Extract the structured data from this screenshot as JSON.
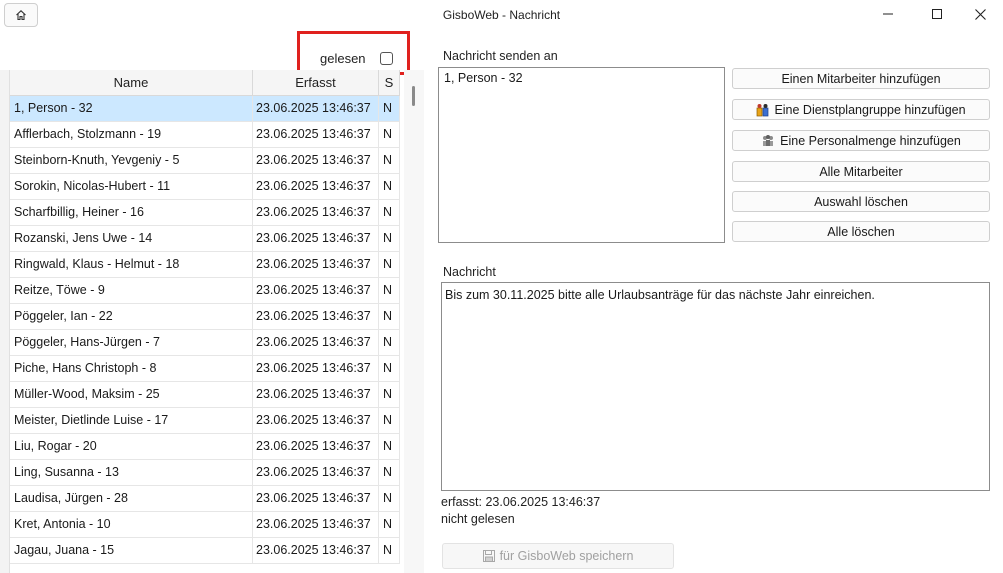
{
  "window": {
    "title": "GisboWeb - Nachricht",
    "home_icon": "home-icon",
    "minimize_icon": "minimize-icon",
    "maximize_icon": "maximize-icon",
    "close_icon": "close-icon"
  },
  "filter": {
    "gelesen_label": "gelesen",
    "gelesen_checked": false
  },
  "table": {
    "columns": [
      "Name",
      "Erfasst",
      "S"
    ],
    "rows": [
      {
        "name": "1, Person - 32",
        "erfasst": "23.06.2025 13:46:37",
        "s": "N"
      },
      {
        "name": "Afflerbach, Stolzmann - 19",
        "erfasst": "23.06.2025 13:46:37",
        "s": "N"
      },
      {
        "name": "Steinborn-Knuth, Yevgeniy - 5",
        "erfasst": "23.06.2025 13:46:37",
        "s": "N"
      },
      {
        "name": "Sorokin, Nicolas-Hubert - 11",
        "erfasst": "23.06.2025 13:46:37",
        "s": "N"
      },
      {
        "name": "Scharfbillig, Heiner - 16",
        "erfasst": "23.06.2025 13:46:37",
        "s": "N"
      },
      {
        "name": "Rozanski, Jens Uwe - 14",
        "erfasst": "23.06.2025 13:46:37",
        "s": "N"
      },
      {
        "name": "Ringwald, Klaus - Helmut - 18",
        "erfasst": "23.06.2025 13:46:37",
        "s": "N"
      },
      {
        "name": "Reitze, Töwe - 9",
        "erfasst": "23.06.2025 13:46:37",
        "s": "N"
      },
      {
        "name": "Pöggeler, Ian - 22",
        "erfasst": "23.06.2025 13:46:37",
        "s": "N"
      },
      {
        "name": "Pöggeler, Hans-Jürgen - 7",
        "erfasst": "23.06.2025 13:46:37",
        "s": "N"
      },
      {
        "name": "Piche, Hans Christoph - 8",
        "erfasst": "23.06.2025 13:46:37",
        "s": "N"
      },
      {
        "name": "Müller-Wood, Maksim - 25",
        "erfasst": "23.06.2025 13:46:37",
        "s": "N"
      },
      {
        "name": "Meister, Dietlinde Luise - 17",
        "erfasst": "23.06.2025 13:46:37",
        "s": "N"
      },
      {
        "name": "Liu, Rogar - 20",
        "erfasst": "23.06.2025 13:46:37",
        "s": "N"
      },
      {
        "name": "Ling, Susanna - 13",
        "erfasst": "23.06.2025 13:46:37",
        "s": "N"
      },
      {
        "name": "Laudisa, Jürgen - 28",
        "erfasst": "23.06.2025 13:46:37",
        "s": "N"
      },
      {
        "name": "Kret, Antonia - 10",
        "erfasst": "23.06.2025 13:46:37",
        "s": "N"
      },
      {
        "name": "Jagau, Juana - 15",
        "erfasst": "23.06.2025 13:46:37",
        "s": "N"
      }
    ],
    "selected_index": 0
  },
  "recipients": {
    "label": "Nachricht senden an",
    "items": [
      "1, Person - 32"
    ]
  },
  "actions": {
    "add_employee": "Einen Mitarbeiter hinzufügen",
    "add_group": "Eine Dienstplangruppe hinzufügen",
    "add_personnel_set": "Eine Personalmenge hinzufügen",
    "all_employees": "Alle Mitarbeiter",
    "clear_selection": "Auswahl löschen",
    "clear_all": "Alle löschen",
    "group_icon": "group-icon",
    "personnel-set_icon": "personnel-set-icon"
  },
  "message": {
    "label": "Nachricht",
    "text": "Bis zum 30.11.2025 bitte alle Urlaubsanträge für das nächste Jahr einreichen.",
    "captured": "erfasst: 23.06.2025 13:46:37",
    "status": "nicht gelesen"
  },
  "save": {
    "label": "für GisboWeb speichern",
    "icon": "save-icon",
    "enabled": false
  },
  "colors": {
    "selection": "#cce8ff",
    "highlight_border": "#e0211e"
  }
}
